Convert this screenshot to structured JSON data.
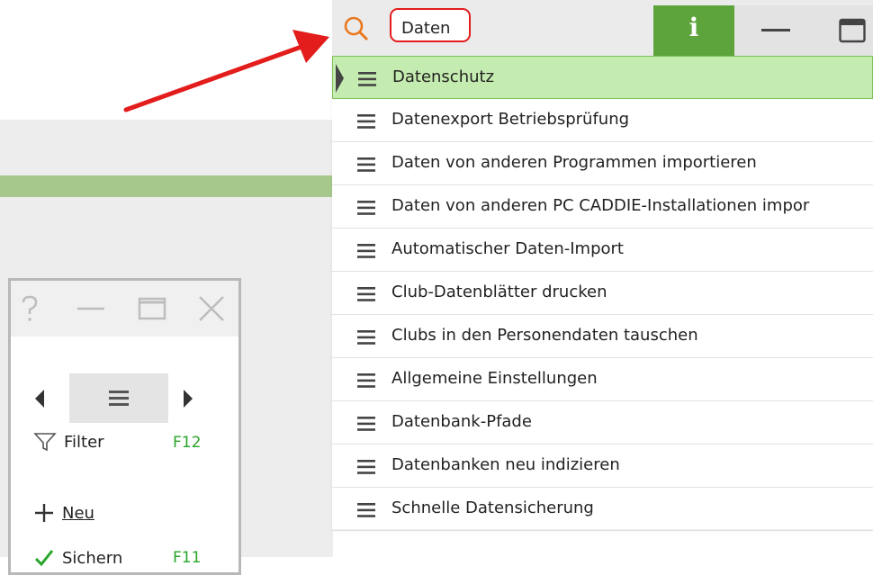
{
  "search": {
    "value": "Daten"
  },
  "toolbar": {
    "info_glyph": "i"
  },
  "results": [
    {
      "label": "Datenschutz",
      "active": true
    },
    {
      "label": "Datenexport Betriebsprüfung",
      "active": false
    },
    {
      "label": "Daten von anderen Programmen importieren",
      "active": false
    },
    {
      "label": "Daten von anderen PC CADDIE-Installationen impor",
      "active": false
    },
    {
      "label": "Automatischer Daten-Import",
      "active": false
    },
    {
      "label": "Club-Datenblätter drucken",
      "active": false
    },
    {
      "label": "Clubs in den Personendaten tauschen",
      "active": false
    },
    {
      "label": "Allgemeine Einstellungen",
      "active": false
    },
    {
      "label": "Datenbank-Pfade",
      "active": false
    },
    {
      "label": "Datenbanken neu indizieren",
      "active": false
    },
    {
      "label": "Schnelle Datensicherung",
      "active": false
    }
  ],
  "subwindow": {
    "filter_label": "Filter",
    "filter_shortcut": "F12",
    "new_label": "Neu",
    "save_label": "Sichern",
    "save_shortcut": "F11"
  },
  "colors": {
    "accent_green": "#5ea43d",
    "active_row": "#c5ecb0",
    "annotation_arrow": "#e31c1c",
    "search_icon": "#e8781e"
  },
  "icons": {
    "search": "search-icon",
    "info": "info-icon",
    "minimize": "minimize-icon",
    "maximize": "maximize-icon",
    "menu": "hamburger-icon"
  }
}
